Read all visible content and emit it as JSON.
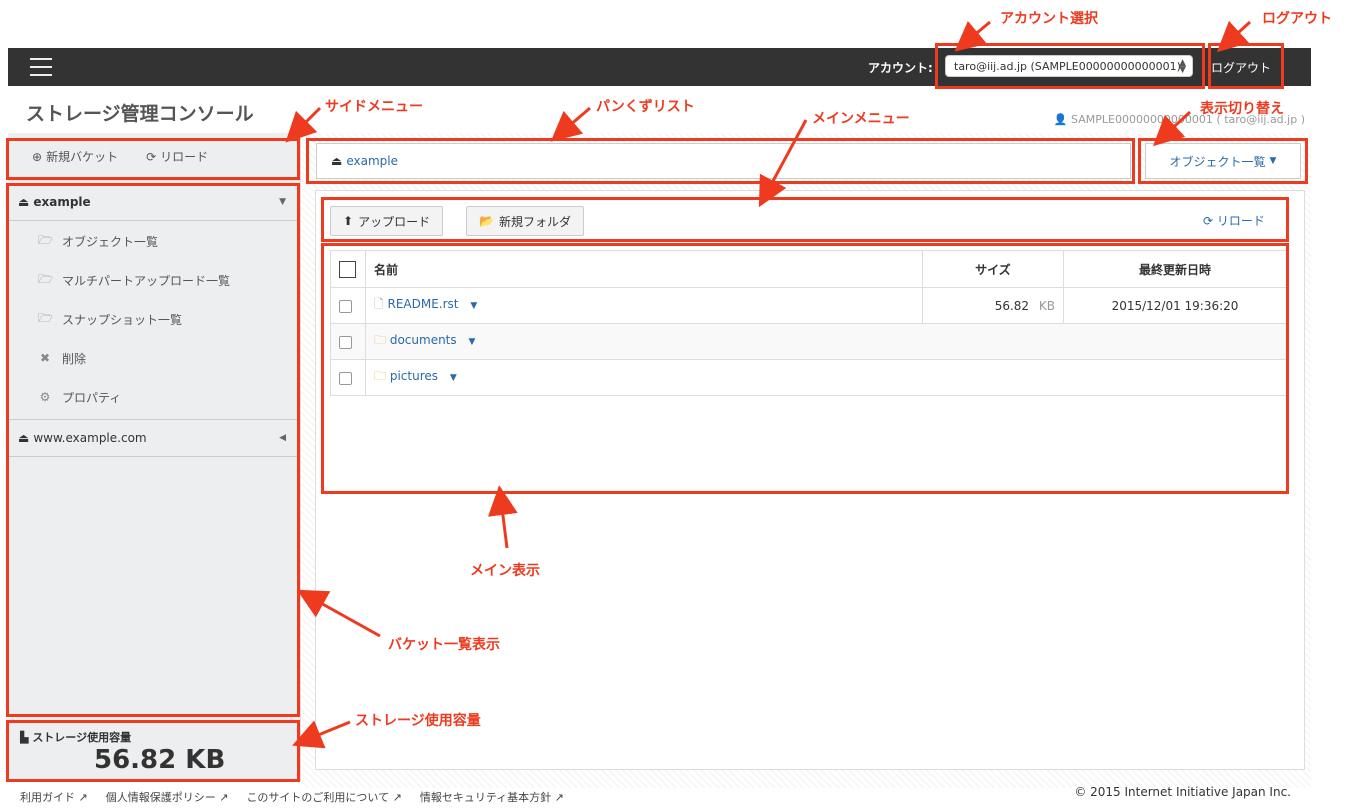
{
  "header": {
    "account_label": "アカウント:",
    "account_selected": "taro@iij.ad.jp (SAMPLE00000000000001)",
    "logout": "ログアウト"
  },
  "app": {
    "title": "ストレージ管理コンソール",
    "user_info": "SAMPLE00000000000001 ( taro@iij.ad.jp )"
  },
  "sidebar": {
    "new_bucket": "新規バケット",
    "reload": "リロード",
    "buckets": [
      {
        "name": "example",
        "expanded": true,
        "items": [
          {
            "label": "オブジェクト一覧",
            "icon": "folder-open-icon"
          },
          {
            "label": "マルチパートアップロード一覧",
            "icon": "folder-open-icon"
          },
          {
            "label": "スナップショット一覧",
            "icon": "folder-open-icon"
          },
          {
            "label": "削除",
            "icon": "close-icon"
          },
          {
            "label": "プロパティ",
            "icon": "gear-icon"
          }
        ]
      },
      {
        "name": "www.example.com",
        "expanded": false
      }
    ],
    "storage_title": "ストレージ使用容量",
    "storage_value": "56.82 KB"
  },
  "breadcrumb": {
    "current": "example"
  },
  "view_switch": {
    "label": "オブジェクト一覧"
  },
  "toolbar": {
    "upload": "アップロード",
    "new_folder": "新規フォルダ",
    "reload": "リロード"
  },
  "table": {
    "headers": {
      "name": "名前",
      "size": "サイズ",
      "modified": "最終更新日時"
    },
    "rows": [
      {
        "type": "file",
        "name": "README.rst",
        "size": "56.82",
        "unit": "KB",
        "modified": "2015/12/01 19:36:20"
      },
      {
        "type": "folder",
        "name": "documents",
        "size": "",
        "unit": "",
        "modified": ""
      },
      {
        "type": "folder",
        "name": "pictures",
        "size": "",
        "unit": "",
        "modified": ""
      }
    ]
  },
  "annotations": {
    "account_select": "アカウント選択",
    "logout": "ログアウト",
    "side_menu": "サイドメニュー",
    "breadcrumb": "パンくずリスト",
    "main_menu": "メインメニュー",
    "view_switch": "表示切り替え",
    "main_view": "メイン表示",
    "bucket_list": "バケット一覧表示",
    "storage_usage": "ストレージ使用容量"
  },
  "footer": {
    "links": [
      "利用ガイド",
      "個人情報保護ポリシー",
      "このサイトのご利用について",
      "情報セキュリティ基本方針"
    ],
    "copyright": "© 2015 Internet Initiative Japan Inc."
  },
  "colors": {
    "annotation": "#ee3b20",
    "link": "#2a6aa8",
    "topbar": "#333333"
  }
}
